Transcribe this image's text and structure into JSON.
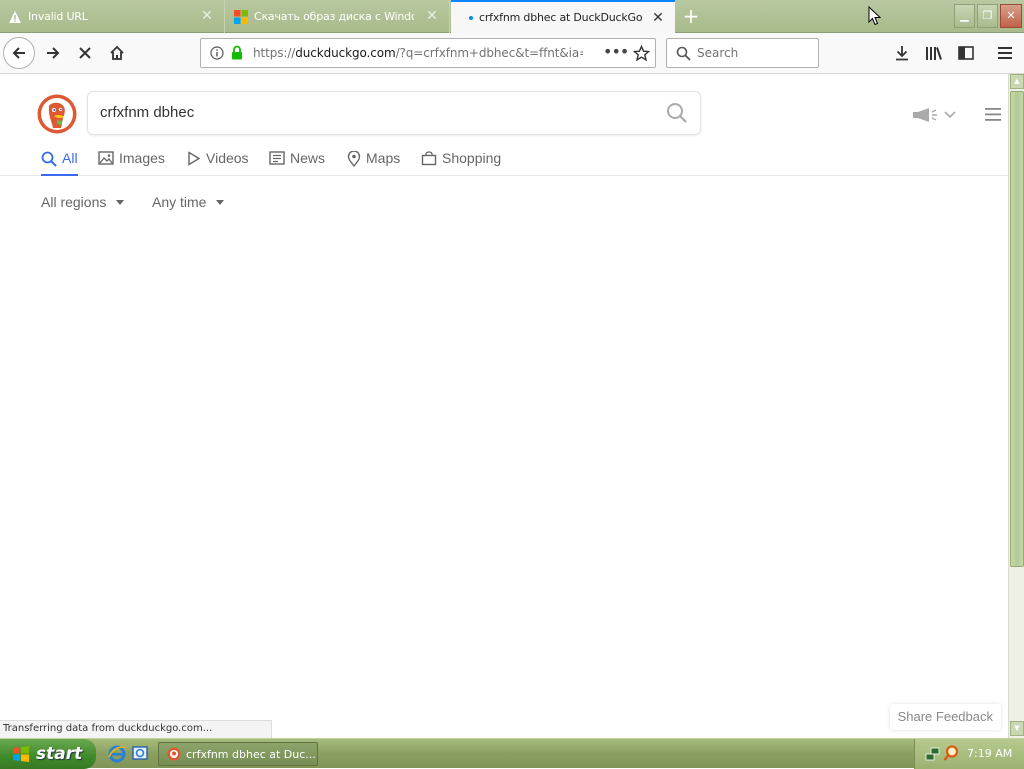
{
  "browser": {
    "tabs": [
      {
        "title": "Invalid URL",
        "icon": "warning-icon"
      },
      {
        "title": "Скачать образ диска с Windows",
        "icon": "microsoft-icon"
      },
      {
        "title": "crfxfnm dbhec at DuckDuckGo",
        "icon": "loading-dot-icon"
      }
    ],
    "active_tab": 2,
    "url": {
      "prefix": "https://",
      "domain": "duckduckgo.com",
      "path": "/?q=crfxfnm+dbhec&t=ffnt&ia="
    },
    "search_placeholder": "Search"
  },
  "ddg": {
    "query": "crfxfnm dbhec",
    "tabs": [
      {
        "label": "All",
        "icon": "search-icon"
      },
      {
        "label": "Images",
        "icon": "image-icon"
      },
      {
        "label": "Videos",
        "icon": "play-icon"
      },
      {
        "label": "News",
        "icon": "news-icon"
      },
      {
        "label": "Maps",
        "icon": "map-pin-icon"
      },
      {
        "label": "Shopping",
        "icon": "shopping-bag-icon"
      }
    ],
    "filters": {
      "region": "All regions",
      "time": "Any time"
    },
    "share_feedback": "Share Feedback"
  },
  "status_text": "Transferring data from duckduckgo.com...",
  "taskbar": {
    "start_label": "start",
    "task_label": "crfxfnm dbhec at Duc...",
    "clock": "7:19 AM"
  },
  "colors": {
    "accent": "#3969ef",
    "firefox_blue": "#0a84ff",
    "ddg_orange": "#de5833",
    "xp_green": "#3f8a2a"
  }
}
